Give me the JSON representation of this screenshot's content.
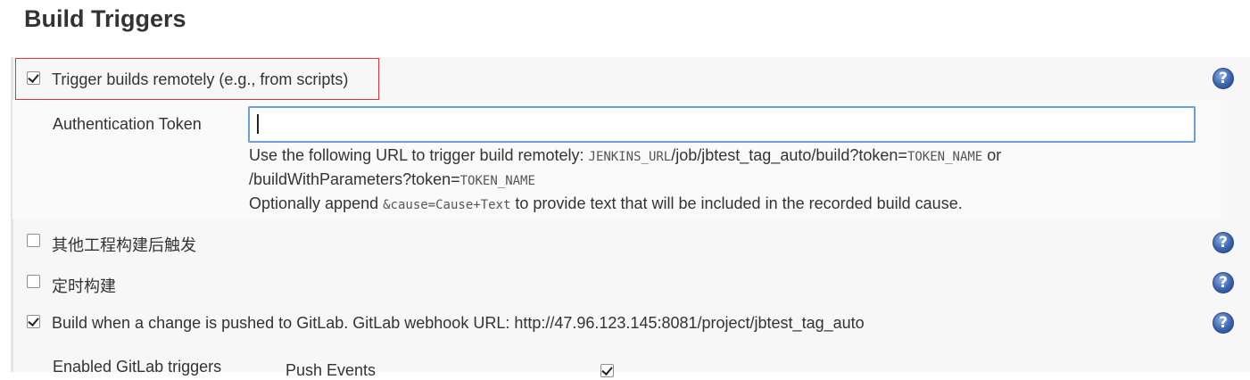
{
  "page": {
    "title": "Build Triggers"
  },
  "triggers": {
    "remote": {
      "label": "Trigger builds remotely (e.g., from scripts)",
      "checked": true
    },
    "auth_token": {
      "label": "Authentication Token",
      "value": "",
      "help": {
        "line1_prefix": "Use the following URL to trigger build remotely: ",
        "line1_code1": "JENKINS_URL",
        "line1_mid": "/job/jbtest_tag_auto/build?token=",
        "line1_code2": "TOKEN_NAME",
        "line1_suffix": " or",
        "line2_prefix": "/buildWithParameters?token=",
        "line2_code": "TOKEN_NAME",
        "line3_prefix": "Optionally append ",
        "line3_code": "&cause=Cause+Text",
        "line3_suffix": " to provide text that will be included in the recorded build cause."
      }
    },
    "after_other": {
      "label": "其他工程构建后触发",
      "checked": false
    },
    "periodic": {
      "label": "定时构建",
      "checked": false
    },
    "gitlab": {
      "label": "Build when a change is pushed to GitLab. GitLab webhook URL: http://47.96.123.145:8081/project/jbtest_tag_auto",
      "checked": true
    },
    "gitlab_enabled": {
      "label": "Enabled GitLab triggers",
      "first_option": "Push Events"
    }
  },
  "icons": {
    "help": "?"
  }
}
